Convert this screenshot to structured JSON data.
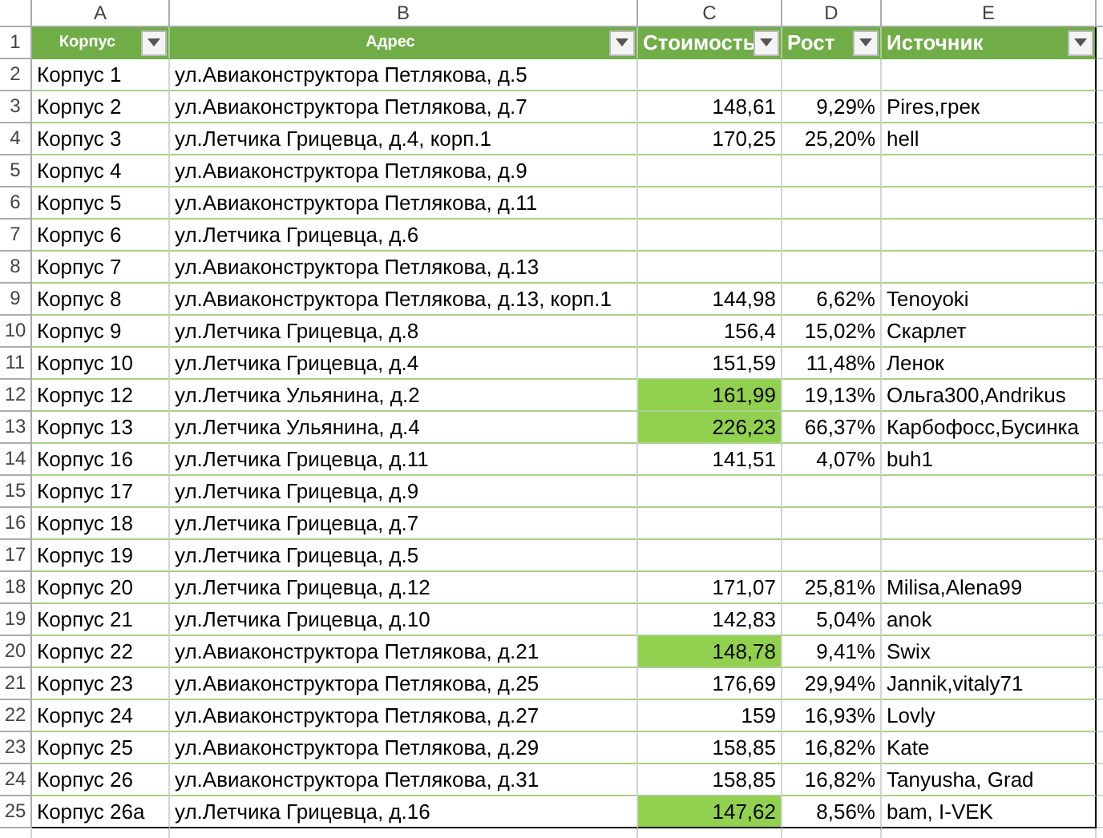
{
  "column_letters": [
    "A",
    "B",
    "C",
    "D",
    "E"
  ],
  "table": {
    "header_row_number": "1",
    "columns": [
      {
        "label": "Корпус",
        "kind": "small",
        "filter": true
      },
      {
        "label": "Адрес",
        "kind": "small",
        "filter": true
      },
      {
        "label": "Стоимость",
        "kind": "large",
        "filter": true
      },
      {
        "label": "Рост",
        "kind": "large",
        "filter": true
      },
      {
        "label": "Источник",
        "kind": "large",
        "filter": true
      }
    ],
    "rows": [
      {
        "row_number": "2",
        "building": "Корпус 1",
        "address": "ул.Авиаконструктора Петлякова, д.5",
        "cost_highlighted": false
      },
      {
        "row_number": "3",
        "building": "Корпус 2",
        "address": "ул.Авиаконструктора Петлякова, д.7",
        "cost": "148,61",
        "growth": "9,29%",
        "source": "Pires,грек",
        "cost_highlighted": false
      },
      {
        "row_number": "4",
        "building": "Корпус 3",
        "address": "ул.Летчика Грицевца, д.4, корп.1",
        "cost": "170,25",
        "growth": "25,20%",
        "source": "hell",
        "cost_highlighted": false
      },
      {
        "row_number": "5",
        "building": "Корпус 4",
        "address": "ул.Авиаконструктора Петлякова, д.9",
        "cost_highlighted": false
      },
      {
        "row_number": "6",
        "building": "Корпус 5",
        "address": "ул.Авиаконструктора Петлякова, д.11",
        "cost_highlighted": false
      },
      {
        "row_number": "7",
        "building": "Корпус 6",
        "address": "ул.Летчика Грицевца, д.6",
        "cost_highlighted": false
      },
      {
        "row_number": "8",
        "building": "Корпус 7",
        "address": "ул.Авиаконструктора Петлякова, д.13",
        "cost_highlighted": false
      },
      {
        "row_number": "9",
        "building": "Корпус 8",
        "address": "ул.Авиаконструктора Петлякова, д.13, корп.1",
        "cost": "144,98",
        "growth": "6,62%",
        "source": "Tenoyoki",
        "cost_highlighted": false
      },
      {
        "row_number": "10",
        "building": "Корпус 9",
        "address": "ул.Летчика Грицевца, д.8",
        "cost": "156,4",
        "growth": "15,02%",
        "source": "Скарлет",
        "cost_highlighted": false
      },
      {
        "row_number": "11",
        "building": "Корпус 10",
        "address": "ул.Летчика Грицевца, д.4",
        "cost": "151,59",
        "growth": "11,48%",
        "source": "Ленок",
        "cost_highlighted": false
      },
      {
        "row_number": "12",
        "building": "Корпус 12",
        "address": "ул.Летчика Ульянина, д.2",
        "cost": "161,99",
        "growth": "19,13%",
        "source": "Ольга300,Andrikus",
        "cost_highlighted": true
      },
      {
        "row_number": "13",
        "building": "Корпус 13",
        "address": "ул.Летчика Ульянина, д.4",
        "cost": "226,23",
        "growth": "66,37%",
        "source": "Карбофосс,Бусинка",
        "cost_highlighted": true
      },
      {
        "row_number": "14",
        "building": "Корпус 16",
        "address": "ул.Летчика Грицевца, д.11",
        "cost": "141,51",
        "growth": "4,07%",
        "source": "buh1",
        "cost_highlighted": false
      },
      {
        "row_number": "15",
        "building": "Корпус 17",
        "address": "ул.Летчика Грицевца, д.9",
        "cost_highlighted": false
      },
      {
        "row_number": "16",
        "building": "Корпус 18",
        "address": "ул.Летчика Грицевца, д.7",
        "cost_highlighted": false
      },
      {
        "row_number": "17",
        "building": "Корпус 19",
        "address": "ул.Летчика Грицевца, д.5",
        "cost_highlighted": false
      },
      {
        "row_number": "18",
        "building": "Корпус 20",
        "address": "ул.Летчика Грицевца, д.12",
        "cost": "171,07",
        "growth": "25,81%",
        "source": "Milisa,Alena99",
        "cost_highlighted": false
      },
      {
        "row_number": "19",
        "building": "Корпус 21",
        "address": "ул.Летчика Грицевца, д.10",
        "cost": "142,83",
        "growth": "5,04%",
        "source": "anok",
        "cost_highlighted": false
      },
      {
        "row_number": "20",
        "building": "Корпус 22",
        "address": "ул.Авиаконструктора Петлякова, д.21",
        "cost": "148,78",
        "growth": "9,41%",
        "source": "Swix",
        "cost_highlighted": true
      },
      {
        "row_number": "21",
        "building": "Корпус 23",
        "address": "ул.Авиаконструктора Петлякова, д.25",
        "cost": "176,69",
        "growth": "29,94%",
        "source": "Jannik,vitaly71",
        "cost_highlighted": false
      },
      {
        "row_number": "22",
        "building": "Корпус 24",
        "address": "ул.Авиаконструктора Петлякова, д.27",
        "cost": "159",
        "growth": "16,93%",
        "source": "Lovly",
        "cost_highlighted": false
      },
      {
        "row_number": "23",
        "building": "Корпус 25",
        "address": "ул.Авиаконструктора Петлякова, д.29",
        "cost": "158,85",
        "growth": "16,82%",
        "source": "Kate",
        "cost_highlighted": false
      },
      {
        "row_number": "24",
        "building": "Корпус 26",
        "address": "ул.Авиаконструктора Петлякова, д.31",
        "cost": "158,85",
        "growth": "16,82%",
        "source": "Tanyusha, Grad",
        "cost_highlighted": false
      },
      {
        "row_number": "25",
        "building": "Корпус 26а",
        "address": "ул.Летчика Грицевца, д.16",
        "cost": "147,62",
        "growth": "8,56%",
        "source": "bam, I-VEK",
        "cost_highlighted": true
      }
    ]
  }
}
